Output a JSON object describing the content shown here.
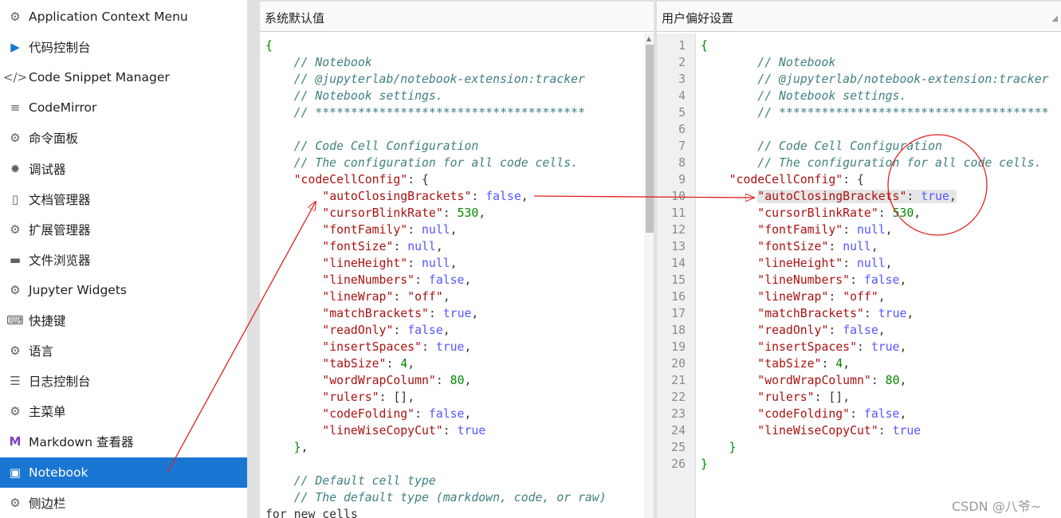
{
  "sidebar": {
    "items": [
      {
        "label": "Application Context Menu",
        "icon": "gear-icon",
        "glyph": "⚙"
      },
      {
        "label": "代码控制台",
        "icon": "console-icon",
        "glyph": "▶"
      },
      {
        "label": "Code Snippet Manager",
        "icon": "code-icon",
        "glyph": "</>"
      },
      {
        "label": "CodeMirror",
        "icon": "text-lines-icon",
        "glyph": "≡"
      },
      {
        "label": "命令面板",
        "icon": "gear-icon",
        "glyph": "⚙"
      },
      {
        "label": "调试器",
        "icon": "bug-icon",
        "glyph": "✹"
      },
      {
        "label": "文档管理器",
        "icon": "file-icon",
        "glyph": "▯"
      },
      {
        "label": "扩展管理器",
        "icon": "gear-icon",
        "glyph": "⚙"
      },
      {
        "label": "文件浏览器",
        "icon": "folder-icon",
        "glyph": "▬"
      },
      {
        "label": "Jupyter Widgets",
        "icon": "gear-icon",
        "glyph": "⚙"
      },
      {
        "label": "快捷键",
        "icon": "keyboard-icon",
        "glyph": "⌨"
      },
      {
        "label": "语言",
        "icon": "gear-icon",
        "glyph": "⚙"
      },
      {
        "label": "日志控制台",
        "icon": "list-icon",
        "glyph": "☰"
      },
      {
        "label": "主菜单",
        "icon": "gear-icon",
        "glyph": "⚙"
      },
      {
        "label": "Markdown 查看器",
        "icon": "markdown-icon",
        "glyph": "M"
      },
      {
        "label": "Notebook",
        "icon": "notebook-icon",
        "glyph": "▣"
      },
      {
        "label": "侧边栏",
        "icon": "gear-icon",
        "glyph": "⚙"
      }
    ],
    "active_index": 15
  },
  "left_pane": {
    "title": "系统默认值",
    "lines": [
      "{",
      "    // Notebook",
      "    // @jupyterlab/notebook-extension:tracker",
      "    // Notebook settings.",
      "    // **************************************",
      "",
      "    // Code Cell Configuration",
      "    // The configuration for all code cells.",
      "    \"codeCellConfig\": {",
      "        \"autoClosingBrackets\": false,",
      "        \"cursorBlinkRate\": 530,",
      "        \"fontFamily\": null,",
      "        \"fontSize\": null,",
      "        \"lineHeight\": null,",
      "        \"lineNumbers\": false,",
      "        \"lineWrap\": \"off\",",
      "        \"matchBrackets\": true,",
      "        \"readOnly\": false,",
      "        \"insertSpaces\": true,",
      "        \"tabSize\": 4,",
      "        \"wordWrapColumn\": 80,",
      "        \"rulers\": [],",
      "        \"codeFolding\": false,",
      "        \"lineWiseCopyCut\": true",
      "    },",
      "",
      "    // Default cell type",
      "    // The default type (markdown, code, or raw)",
      "for new cells"
    ]
  },
  "right_pane": {
    "title": "用户偏好设置",
    "line_numbers": [
      "1",
      "2",
      "3",
      "4",
      "5",
      "6",
      "7",
      "8",
      "9",
      "10",
      "11",
      "12",
      "13",
      "14",
      "15",
      "16",
      "17",
      "18",
      "19",
      "20",
      "21",
      "22",
      "23",
      "24",
      "25",
      "26"
    ],
    "lines": [
      "{",
      "        // Notebook",
      "        // @jupyterlab/notebook-extension:tracker",
      "        // Notebook settings.",
      "        // **************************************",
      "",
      "        // Code Cell Configuration",
      "        // The configuration for all code cells.",
      "    \"codeCellConfig\": {",
      "        \"autoClosingBrackets\": true,",
      "        \"cursorBlinkRate\": 530,",
      "        \"fontFamily\": null,",
      "        \"fontSize\": null,",
      "        \"lineHeight\": null,",
      "        \"lineNumbers\": false,",
      "        \"lineWrap\": \"off\",",
      "        \"matchBrackets\": true,",
      "        \"readOnly\": false,",
      "        \"insertSpaces\": true,",
      "        \"tabSize\": 4,",
      "        \"wordWrapColumn\": 80,",
      "        \"rulers\": [],",
      "        \"codeFolding\": false,",
      "        \"lineWiseCopyCut\": true",
      "    }",
      "}"
    ],
    "highlight_index": 9
  },
  "watermark": "CSDN @八爷~",
  "colors": {
    "accent": "#1976d2",
    "annotation": "#e02020",
    "comment": "#408080",
    "key": "#aa1111",
    "keyword": "#5555ff",
    "number": "#008800"
  }
}
